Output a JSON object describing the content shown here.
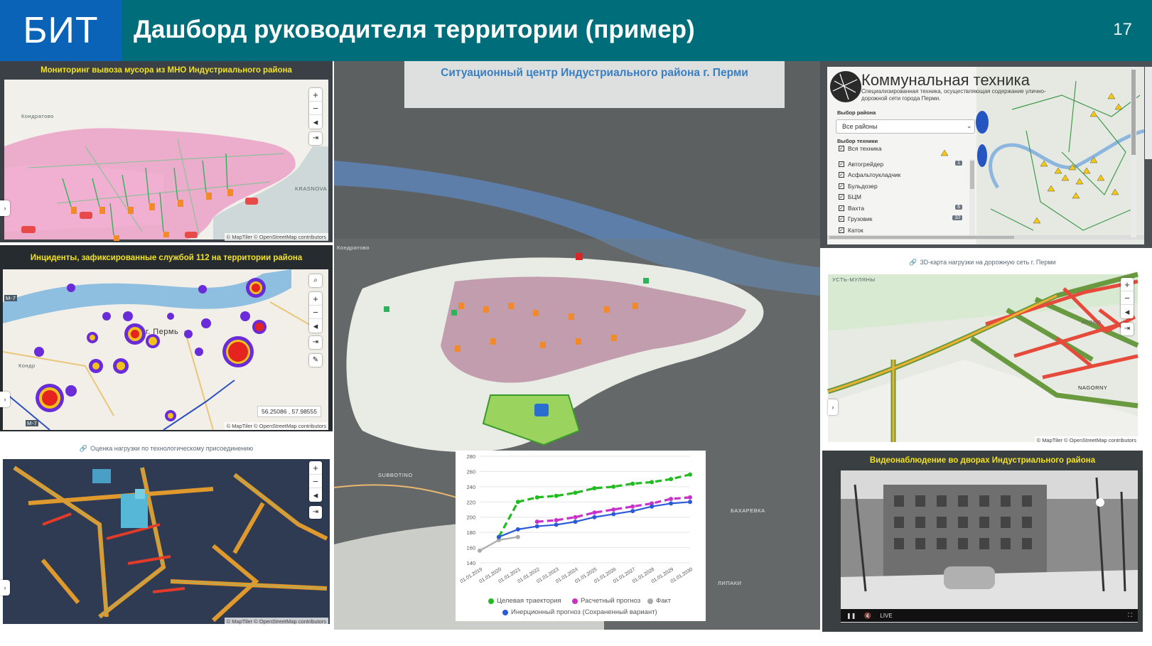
{
  "header": {
    "logo": "БИТ",
    "title": "Дашборд руководителя территории (пример)",
    "page_number": "17"
  },
  "colors": {
    "header_bg": "#006d7a",
    "logo_bg": "#0a63b6",
    "panel_title": "#f3e21e"
  },
  "panels": {
    "garbage": {
      "title": "Мониторинг вывоза мусора из МНО Индустриального района",
      "labels": [
        "Кондратово",
        "KRASNOVA"
      ],
      "attribution": "© MapTiler © OpenStreetMap contributors"
    },
    "incidents": {
      "title": "Инциденты, зафиксированные службой 112 на территории района",
      "city_label": "г. Пермь",
      "labels": [
        "Кондр",
        "M-7",
        "M-7"
      ],
      "coords": "56.25086 , 57.98555",
      "attribution": "© MapTiler © OpenStreetMap contributors"
    },
    "tech_load": {
      "title": "Оценка нагрузки по технологическому присоединению",
      "attribution": "© MapTiler © OpenStreetMap contributors"
    },
    "situation": {
      "title": "Ситуационный центр Индустриального района г. Перми",
      "labels": [
        "Кондратово",
        "SUBBOTINO",
        "БАХАРЕВКА",
        "ЛИПАКИ"
      ]
    },
    "municipal": {
      "title": "Коммунальная техника",
      "subtitle": "Специализированная техника, осуществляющая содержание улично-дорожной сети города Перми.",
      "district_label": "Выбор района",
      "district_value": "Все районы",
      "tech_label": "Выбор техники",
      "items": [
        {
          "label": "Вся техника",
          "count": ""
        },
        {
          "label": "Автогрейдер",
          "count": "1"
        },
        {
          "label": "Асфальтоукладчик",
          "count": ""
        },
        {
          "label": "Бульдозер",
          "count": ""
        },
        {
          "label": "БЦМ",
          "count": ""
        },
        {
          "label": "Вахта",
          "count": "6"
        },
        {
          "label": "Грузовик",
          "count": "10"
        },
        {
          "label": "Каток",
          "count": ""
        }
      ]
    },
    "roads3d": {
      "title": "3D-карта нагрузки на дорожную сеть г. Перми",
      "labels": [
        "УСТЬ-МУЛЯНЫ",
        "АТОВО",
        "NAGORNY"
      ],
      "attribution": "© MapTiler © OpenStreetMap contributors"
    },
    "video": {
      "title": "Видеонаблюдение во дворах Индустриального района",
      "live": "LIVE"
    }
  },
  "chart_data": {
    "type": "line",
    "x": [
      "01.01.2019",
      "01.01.2020",
      "01.01.2021",
      "01.01.2022",
      "01.01.2023",
      "01.01.2024",
      "01.01.2025",
      "01.01.2026",
      "01.01.2027",
      "01.01.2028",
      "01.01.2029",
      "01.01.2030"
    ],
    "ylim": [
      140,
      280
    ],
    "yticks": [
      140,
      160,
      180,
      200,
      220,
      240,
      260,
      280
    ],
    "series": [
      {
        "name": "Целевая траектория",
        "color": "#22bb22",
        "dash": true,
        "values": [
          null,
          174,
          220,
          226,
          228,
          232,
          238,
          240,
          244,
          246,
          250,
          256
        ]
      },
      {
        "name": "Расчетный прогноз",
        "color": "#c832c8",
        "dash": true,
        "values": [
          null,
          null,
          null,
          194,
          196,
          200,
          206,
          210,
          214,
          218,
          224,
          226
        ]
      },
      {
        "name": "Факт",
        "color": "#aaaaaa",
        "dash": false,
        "values": [
          156,
          170,
          174,
          null,
          null,
          null,
          null,
          null,
          null,
          null,
          null,
          null
        ]
      },
      {
        "name": "Инерционный прогноз (Сохраненный вариант)",
        "color": "#2a5ad8",
        "dash": false,
        "values": [
          null,
          174,
          184,
          188,
          190,
          194,
          200,
          204,
          208,
          214,
          218,
          220
        ]
      }
    ]
  }
}
